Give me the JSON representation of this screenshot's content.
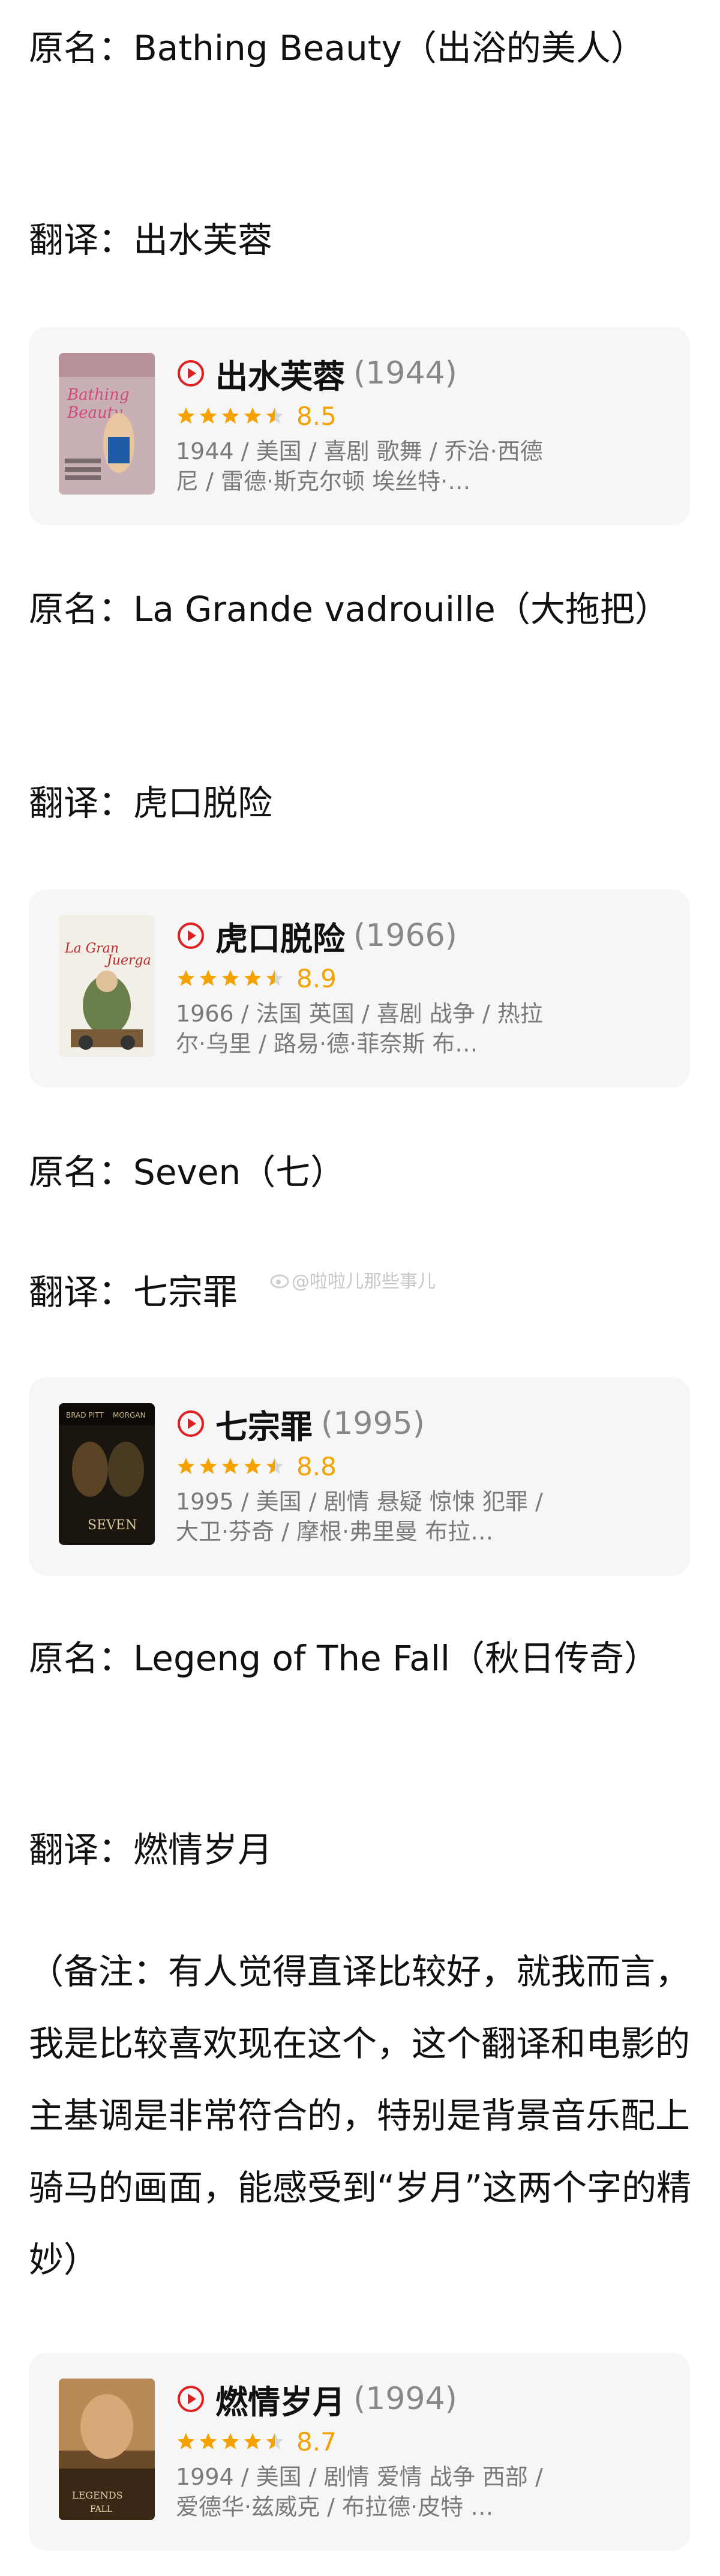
{
  "sections": [
    {
      "original": "原名：Bathing Beauty（出浴的美人）",
      "translation": "翻译：出水芙蓉",
      "card": {
        "title": "出水芙蓉",
        "year": "(1944)",
        "rating": "8.5",
        "stars": 4.5,
        "meta": "1944 / 美国 / 喜剧 歌舞 / 乔治·西德尼 / 雷德·斯克尔顿 埃丝特·…"
      }
    },
    {
      "original": "原名：La Grande vadrouille（大拖把）",
      "translation": "翻译：虎口脱险",
      "card": {
        "title": "虎口脱险",
        "year": "(1966)",
        "rating": "8.9",
        "stars": 4.5,
        "meta": "1966 / 法国 英国 / 喜剧 战争 / 热拉尔·乌里 / 路易·德·菲奈斯 布…"
      }
    },
    {
      "original": "原名：Seven（七）",
      "translation": "翻译：七宗罪",
      "card": {
        "title": "七宗罪",
        "year": "(1995)",
        "rating": "8.8",
        "stars": 4.5,
        "meta": "1995 / 美国 / 剧情 悬疑 惊悚 犯罪 / 大卫·芬奇 / 摩根·弗里曼 布拉…"
      }
    },
    {
      "original": "原名：Legeng of The Fall（秋日传奇）",
      "translation": "翻译：燃情岁月",
      "note": "（备注：有人觉得直译比较好，就我而言，我是比较喜欢现在这个，这个翻译和电影的主基调是非常符合的，特别是背景音乐配上骑马的画面，能感受到“岁月”这两个字的精妙）",
      "card": {
        "title": "燃情岁月",
        "year": "(1994)",
        "rating": "8.7",
        "stars": 4.5,
        "meta": "1994 / 美国 / 剧情 爱情 战争 西部 / 爱德华·兹威克 / 布拉德·皮特 …"
      }
    }
  ],
  "watermark": "@啦啦儿那些事儿",
  "colors": {
    "accent_red": "#e02020",
    "star_gold": "#f5a200",
    "card_bg": "#f6f6f6",
    "meta_gray": "#7a7a7a"
  },
  "icons": {
    "play": "play-circle-icon",
    "star": "star-icon",
    "watermark": "weibo-icon"
  }
}
